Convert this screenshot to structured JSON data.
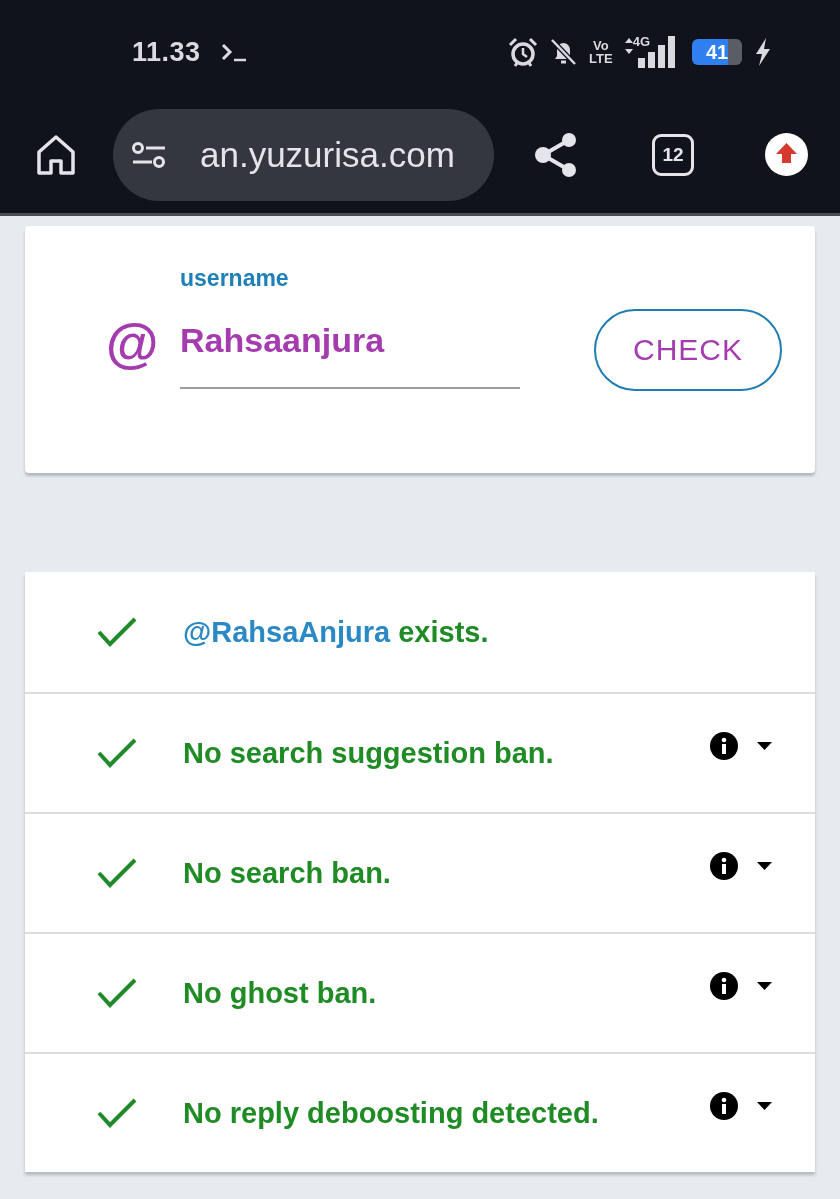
{
  "status_bar": {
    "time": "11.33",
    "volte": [
      "Vo",
      "LTE"
    ],
    "network_type": "4G",
    "battery": "41"
  },
  "browser_bar": {
    "url": "an.yuzurisa.com",
    "tab_count": "12"
  },
  "username_form": {
    "prefix": "@",
    "label": "username",
    "value": "Rahsaanjura",
    "button": "CHECK"
  },
  "results": [
    {
      "kind": "account",
      "passed": true,
      "handle": "@RahsaAnjura",
      "text": "exists."
    },
    {
      "kind": "test",
      "passed": true,
      "text": "No search suggestion ban."
    },
    {
      "kind": "test",
      "passed": true,
      "text": "No search ban."
    },
    {
      "kind": "test",
      "passed": true,
      "text": "No ghost ban."
    },
    {
      "kind": "test",
      "passed": true,
      "text": "No reply deboosting detected."
    }
  ]
}
